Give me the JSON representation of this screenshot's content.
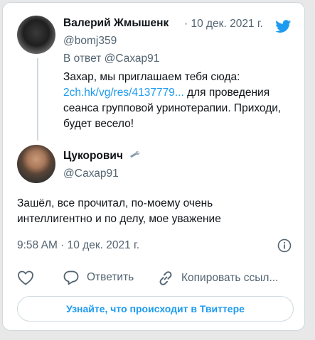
{
  "parent_tweet": {
    "author_name": "Валерий Жмышенк",
    "date": "· 10 дек. 2021 г.",
    "handle": "@bomj359",
    "reply_to": "В ответ @Сахар91",
    "text_before_link": "Захар, мы приглашаем тебя сюда:",
    "link": "2ch.hk/vg/res/4137779...",
    "text_after_link": " для проведения сеанса групповой уринотерапии. Приходи, будет весело!"
  },
  "main_tweet": {
    "author_name": "Цукорович",
    "handle": "@Сахар91",
    "text": "Зашёл, все прочитал, по-моему очень интеллигентно и по делу, мое уважение",
    "timestamp": "9:58 AM · 10 дек. 2021 г."
  },
  "actions": {
    "reply_label": "Ответить",
    "copy_label": "Копировать ссыл..."
  },
  "cta_label": "Узнайте, что происходит в Твиттере",
  "colors": {
    "twitter_blue": "#1d9bf0",
    "muted": "#536471",
    "border": "#cfd9de"
  },
  "icons": [
    "twitter-bird-icon",
    "wrench-icon",
    "info-icon",
    "heart-icon",
    "reply-icon",
    "link-icon"
  ]
}
